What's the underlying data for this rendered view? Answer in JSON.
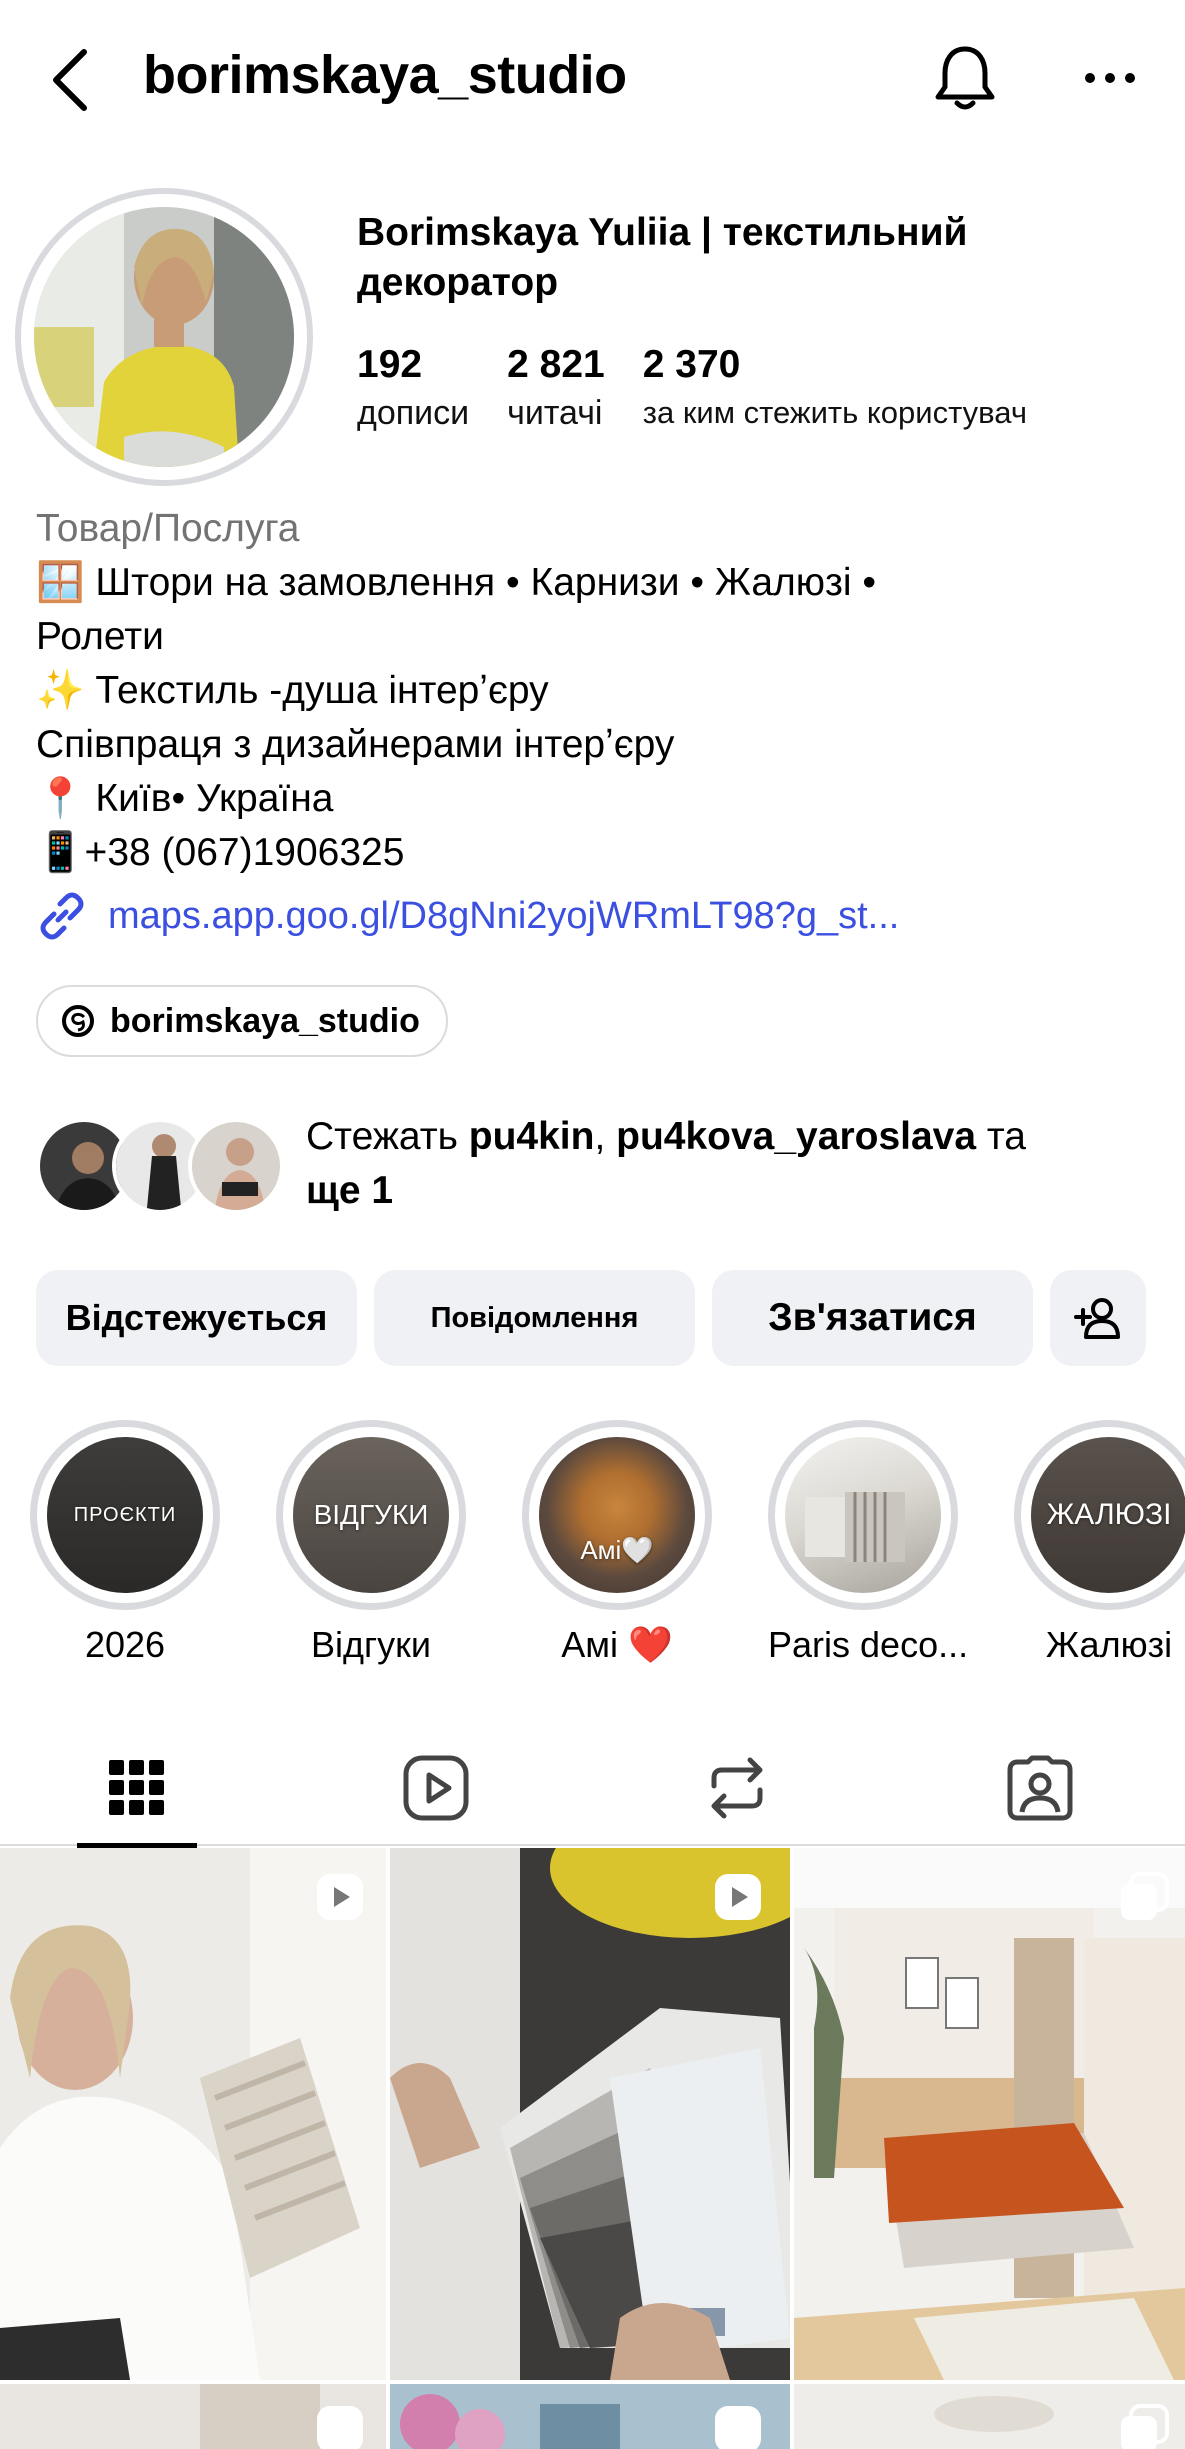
{
  "header": {
    "username": "borimskaya_studio"
  },
  "profile": {
    "full_name": "Borimskaya Yuliia | текстильний декоратор",
    "stats": [
      {
        "value": "192",
        "label": "дописи"
      },
      {
        "value": "2 821",
        "label": "читачі"
      },
      {
        "value": "2 370",
        "label": "за ким стежить користувач"
      }
    ],
    "category": "Товар/Послуга",
    "bio_lines": [
      "🪟 Штори на замовлення • Карнизи • Жалюзі •",
      "Ролети",
      "✨ Текстиль -душа інтерʼєру",
      "Співпраця з дизайнерами інтерʼєру",
      "📍 Київ• Україна",
      "📱+38 (067)1906325"
    ],
    "link": "maps.app.goo.gl/D8gNni2yojWRmLT98?g_st...",
    "threads_handle": "borimskaya_studio"
  },
  "followed_by": {
    "prefix": "Стежать ",
    "user1": "pu4kin",
    "separator": ", ",
    "user2": "pu4kova_yaroslava",
    "middle": " та",
    "more": "ще 1"
  },
  "actions": {
    "following": "Відстежується",
    "message": "Повідомлення",
    "contact": "Зв'язатися"
  },
  "highlights": [
    {
      "cover_text": "ПРОЄКТИ",
      "label": "2026"
    },
    {
      "cover_text": "ВІДГУКИ",
      "label": "Відгуки"
    },
    {
      "cover_text": "Амі🤍",
      "label": "Амі ❤️"
    },
    {
      "cover_text": "",
      "label": "Paris deco..."
    },
    {
      "cover_text": "ЖАЛЮЗІ",
      "label": "Жалюзі"
    }
  ],
  "tabs": [
    "posts-grid",
    "reels",
    "reposts",
    "tagged"
  ],
  "colors": {
    "link": "#3b4fe0",
    "button_bg": "#eff1f4",
    "ring": "#d8dade",
    "muted": "#737373"
  }
}
